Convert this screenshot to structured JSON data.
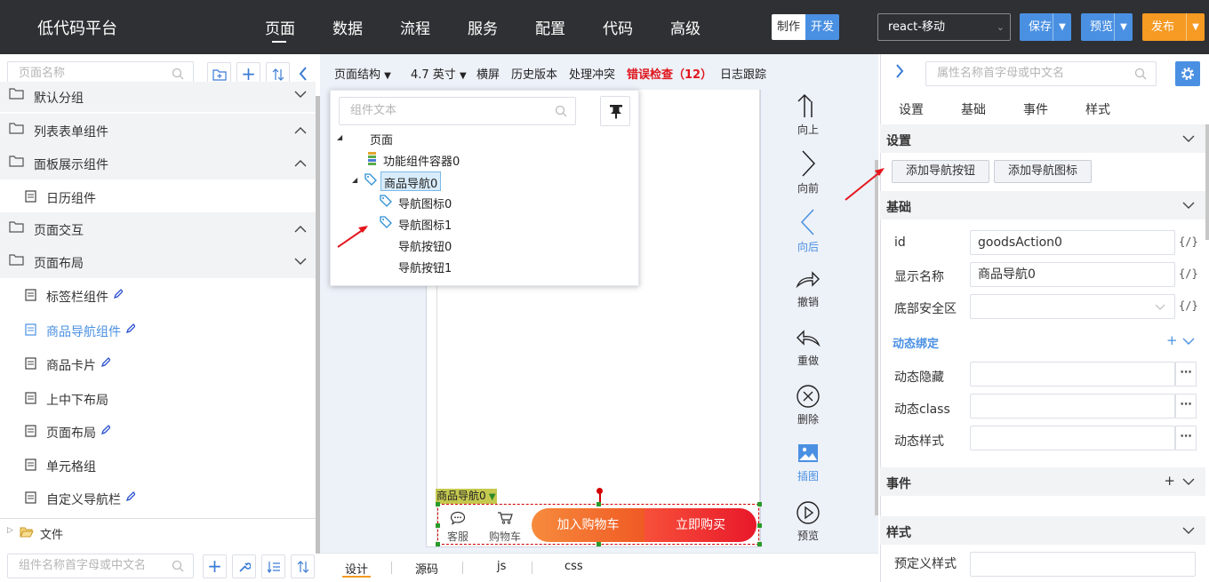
{
  "app": {
    "title": "低代码平台"
  },
  "nav": [
    "页面",
    "数据",
    "流程",
    "服务",
    "配置",
    "代码",
    "高级"
  ],
  "mode_toggle": {
    "make": "制作",
    "dev": "开发"
  },
  "platform_select": "react-移动",
  "toolbar": {
    "save": "保存",
    "preview": "预览",
    "publish": "发布"
  },
  "colors": {
    "topbar": "#2f3033",
    "accent": "#4a90e2",
    "publish": "#f59a23",
    "error": "#e0161d",
    "cart_btn": "#f05a24",
    "buy_btn": "#e8182a"
  },
  "left": {
    "search_placeholder": "页面名称",
    "groups": [
      {
        "label": "默认分组"
      },
      {
        "label": "列表表单组件"
      },
      {
        "label": "面板展示组件"
      },
      {
        "label": "日历组件"
      },
      {
        "label": "页面交互"
      },
      {
        "label": "页面布局"
      }
    ],
    "items": [
      {
        "label": "标签栏组件"
      },
      {
        "label": "商品导航组件"
      },
      {
        "label": "商品卡片"
      },
      {
        "label": "上中下布局"
      },
      {
        "label": "页面布局"
      },
      {
        "label": "单元格组"
      },
      {
        "label": "自定义导航栏"
      }
    ],
    "files": "文件",
    "component_search_placeholder": "组件名称首字母或中文名"
  },
  "center": {
    "tools": [
      "页面结构",
      "4.7 英寸",
      "横屏",
      "历史版本",
      "处理冲突",
      "日志跟踪"
    ],
    "error_check": "错误检查（12）",
    "tree": {
      "search_placeholder": "组件文本",
      "nodes": [
        "页面",
        "功能组件容器0",
        "商品导航0",
        "导航图标0",
        "导航图标1",
        "导航按钮0",
        "导航按钮1"
      ]
    },
    "component_tag": "商品导航0",
    "goods_action": {
      "icon1": "客服",
      "icon2": "购物车",
      "btn1": "加入购物车",
      "btn2": "立即购买"
    },
    "right_tools": [
      "向上",
      "向前",
      "向后",
      "撤销",
      "重做",
      "删除",
      "插图",
      "预览"
    ],
    "bottom_tabs": [
      "设计",
      "源码",
      "js",
      "css"
    ]
  },
  "right": {
    "search_placeholder": "属性名称首字母或中文名",
    "tabs": [
      "设置",
      "基础",
      "事件",
      "样式"
    ],
    "section_settings": "设置",
    "add_nav_button": "添加导航按钮",
    "add_nav_icon": "添加导航图标",
    "section_basic": "基础",
    "fields": {
      "id_label": "id",
      "id_value": "goodsAction0",
      "name_label": "显示名称",
      "name_value": "商品导航0",
      "safe_area_label": "底部安全区"
    },
    "fx": "{/}",
    "dynamic_binding": "动态绑定",
    "dynamic_fields": [
      "动态隐藏",
      "动态class",
      "动态样式"
    ],
    "section_events": "事件",
    "section_style": "样式",
    "predefined_style": "预定义样式"
  }
}
